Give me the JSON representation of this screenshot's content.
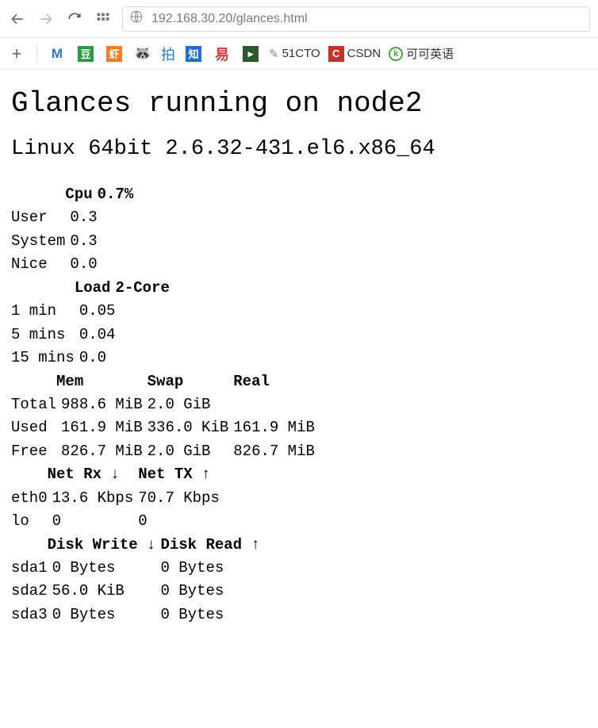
{
  "browser": {
    "url": "192.168.30.20/glances.html",
    "bookmarks": {
      "pai": "拍",
      "zhi": "知",
      "cto": "51CTO",
      "csdn": "CSDN",
      "keke": "可可英语"
    }
  },
  "page": {
    "title": "Glances running on node2",
    "subtitle": "Linux 64bit 2.6.32-431.el6.x86_64"
  },
  "cpu": {
    "header": "Cpu",
    "pct": "0.7%",
    "rows": [
      {
        "label": "User",
        "value": "0.3"
      },
      {
        "label": "System",
        "value": "0.3"
      },
      {
        "label": "Nice",
        "value": "0.0"
      }
    ]
  },
  "load": {
    "header": "Load",
    "cores": "2-Core",
    "rows": [
      {
        "label": "1 min",
        "value": "0.05"
      },
      {
        "label": "5 mins",
        "value": "0.04"
      },
      {
        "label": "15 mins",
        "value": "0.0"
      }
    ]
  },
  "mem": {
    "h_mem": "Mem",
    "h_swap": "Swap",
    "h_real": "Real",
    "rows": [
      {
        "label": "Total",
        "mem": "988.6 MiB",
        "swap": "2.0 GiB",
        "real": ""
      },
      {
        "label": "Used",
        "mem": "161.9 MiB",
        "swap": "336.0 KiB",
        "real": "161.9 MiB"
      },
      {
        "label": "Free",
        "mem": "826.7 MiB",
        "swap": "2.0 GiB",
        "real": "826.7 MiB"
      }
    ]
  },
  "net": {
    "h_rx": "Net Rx ↓",
    "h_tx": "Net TX ↑",
    "rows": [
      {
        "iface": "eth0",
        "rx": "13.6 Kbps",
        "tx": "70.7 Kbps"
      },
      {
        "iface": "lo",
        "rx": "0",
        "tx": "0"
      }
    ]
  },
  "disk": {
    "h_write": "Disk Write ↓",
    "h_read": "Disk Read ↑",
    "rows": [
      {
        "dev": "sda1",
        "write": "0 Bytes",
        "read": "0 Bytes"
      },
      {
        "dev": "sda2",
        "write": "56.0 KiB",
        "read": "0 Bytes"
      },
      {
        "dev": "sda3",
        "write": "0 Bytes",
        "read": "0 Bytes"
      }
    ]
  }
}
